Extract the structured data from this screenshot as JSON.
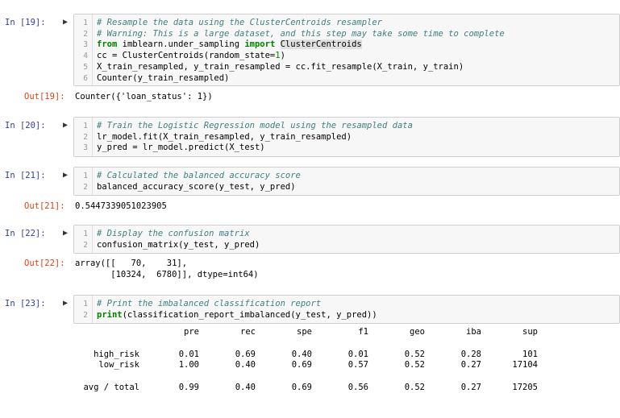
{
  "cells": [
    {
      "in_prompt": "In [19]:",
      "lines": [
        {
          "n": "1",
          "text": "# Resample the data using the ClusterCentroids resampler"
        },
        {
          "n": "2",
          "text": "# Warning: This is a large dataset, and this step may take some time to complete"
        },
        {
          "n": "3",
          "parts": [
            "from",
            " imblearn.under_sampling ",
            "import",
            " ",
            "ClusterCentroids"
          ]
        },
        {
          "n": "4",
          "parts": [
            "cc = ClusterCentroids(random_state=",
            "1",
            ")"
          ]
        },
        {
          "n": "5",
          "text": "X_train_resampled, y_train_resampled = cc.fit_resample(X_train, y_train)"
        },
        {
          "n": "6",
          "text": "Counter(y_train_resampled)"
        }
      ],
      "out_prompt": "Out[19]:",
      "output": "Counter({'loan_status': 1})"
    },
    {
      "in_prompt": "In [20]:",
      "lines": [
        {
          "n": "1",
          "text": "# Train the Logistic Regression model using the resampled data"
        },
        {
          "n": "2",
          "text": "lr_model.fit(X_train_resampled, y_train_resampled)"
        },
        {
          "n": "3",
          "text": "y_pred = lr_model.predict(X_test)"
        }
      ]
    },
    {
      "in_prompt": "In [21]:",
      "lines": [
        {
          "n": "1",
          "text": "# Calculated the balanced accuracy score"
        },
        {
          "n": "2",
          "text": "balanced_accuracy_score(y_test, y_pred)"
        }
      ],
      "out_prompt": "Out[21]:",
      "output": "0.5447339051023905"
    },
    {
      "in_prompt": "In [22]:",
      "lines": [
        {
          "n": "1",
          "text": "# Display the confusion matrix"
        },
        {
          "n": "2",
          "text": "confusion_matrix(y_test, y_pred)"
        }
      ],
      "out_prompt": "Out[22]:",
      "output_line1": "array([[   70,    31],",
      "output_line2": "       [10324,  6780]], dtype=int64)"
    },
    {
      "in_prompt": "In [23]:",
      "lines": [
        {
          "n": "1",
          "text": "# Print the imbalanced classification report"
        },
        {
          "n": "2",
          "parts": [
            "print",
            "(classification_report_imbalanced(y_test, y_pred))"
          ]
        }
      ]
    }
  ],
  "report": {
    "headers": [
      "pre",
      "rec",
      "spe",
      "f1",
      "geo",
      "iba",
      "sup"
    ],
    "rows": [
      {
        "label": "high_risk",
        "values": [
          "0.01",
          "0.69",
          "0.40",
          "0.01",
          "0.52",
          "0.28",
          "101"
        ]
      },
      {
        "label": "low_risk",
        "values": [
          "1.00",
          "0.40",
          "0.69",
          "0.57",
          "0.52",
          "0.27",
          "17104"
        ]
      },
      {
        "label": "avg / total",
        "values": [
          "0.99",
          "0.40",
          "0.69",
          "0.56",
          "0.52",
          "0.27",
          "17205"
        ]
      }
    ]
  },
  "icons": {
    "run": "run-pointer-icon"
  }
}
